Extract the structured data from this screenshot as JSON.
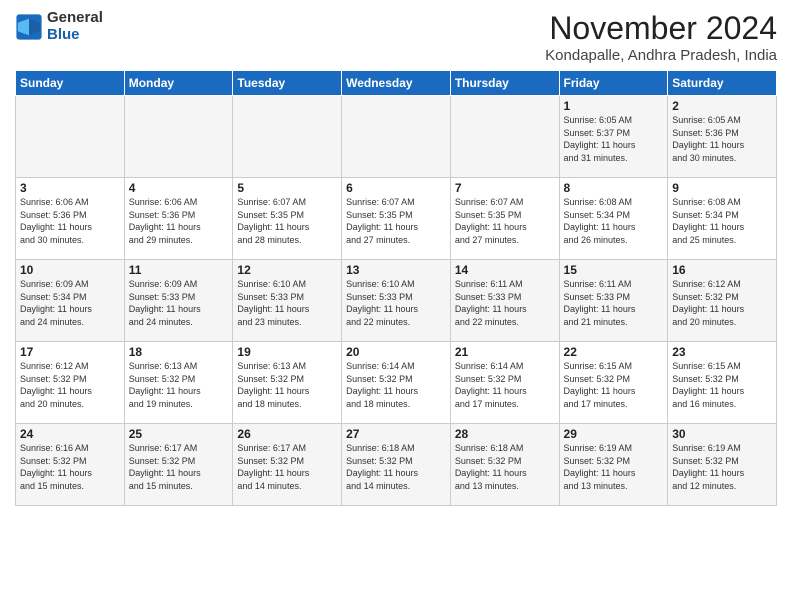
{
  "header": {
    "logo_general": "General",
    "logo_blue": "Blue",
    "month": "November 2024",
    "location": "Kondapalle, Andhra Pradesh, India"
  },
  "weekdays": [
    "Sunday",
    "Monday",
    "Tuesday",
    "Wednesday",
    "Thursday",
    "Friday",
    "Saturday"
  ],
  "weeks": [
    [
      {
        "day": "",
        "info": ""
      },
      {
        "day": "",
        "info": ""
      },
      {
        "day": "",
        "info": ""
      },
      {
        "day": "",
        "info": ""
      },
      {
        "day": "",
        "info": ""
      },
      {
        "day": "1",
        "info": "Sunrise: 6:05 AM\nSunset: 5:37 PM\nDaylight: 11 hours\nand 31 minutes."
      },
      {
        "day": "2",
        "info": "Sunrise: 6:05 AM\nSunset: 5:36 PM\nDaylight: 11 hours\nand 30 minutes."
      }
    ],
    [
      {
        "day": "3",
        "info": "Sunrise: 6:06 AM\nSunset: 5:36 PM\nDaylight: 11 hours\nand 30 minutes."
      },
      {
        "day": "4",
        "info": "Sunrise: 6:06 AM\nSunset: 5:36 PM\nDaylight: 11 hours\nand 29 minutes."
      },
      {
        "day": "5",
        "info": "Sunrise: 6:07 AM\nSunset: 5:35 PM\nDaylight: 11 hours\nand 28 minutes."
      },
      {
        "day": "6",
        "info": "Sunrise: 6:07 AM\nSunset: 5:35 PM\nDaylight: 11 hours\nand 27 minutes."
      },
      {
        "day": "7",
        "info": "Sunrise: 6:07 AM\nSunset: 5:35 PM\nDaylight: 11 hours\nand 27 minutes."
      },
      {
        "day": "8",
        "info": "Sunrise: 6:08 AM\nSunset: 5:34 PM\nDaylight: 11 hours\nand 26 minutes."
      },
      {
        "day": "9",
        "info": "Sunrise: 6:08 AM\nSunset: 5:34 PM\nDaylight: 11 hours\nand 25 minutes."
      }
    ],
    [
      {
        "day": "10",
        "info": "Sunrise: 6:09 AM\nSunset: 5:34 PM\nDaylight: 11 hours\nand 24 minutes."
      },
      {
        "day": "11",
        "info": "Sunrise: 6:09 AM\nSunset: 5:33 PM\nDaylight: 11 hours\nand 24 minutes."
      },
      {
        "day": "12",
        "info": "Sunrise: 6:10 AM\nSunset: 5:33 PM\nDaylight: 11 hours\nand 23 minutes."
      },
      {
        "day": "13",
        "info": "Sunrise: 6:10 AM\nSunset: 5:33 PM\nDaylight: 11 hours\nand 22 minutes."
      },
      {
        "day": "14",
        "info": "Sunrise: 6:11 AM\nSunset: 5:33 PM\nDaylight: 11 hours\nand 22 minutes."
      },
      {
        "day": "15",
        "info": "Sunrise: 6:11 AM\nSunset: 5:33 PM\nDaylight: 11 hours\nand 21 minutes."
      },
      {
        "day": "16",
        "info": "Sunrise: 6:12 AM\nSunset: 5:32 PM\nDaylight: 11 hours\nand 20 minutes."
      }
    ],
    [
      {
        "day": "17",
        "info": "Sunrise: 6:12 AM\nSunset: 5:32 PM\nDaylight: 11 hours\nand 20 minutes."
      },
      {
        "day": "18",
        "info": "Sunrise: 6:13 AM\nSunset: 5:32 PM\nDaylight: 11 hours\nand 19 minutes."
      },
      {
        "day": "19",
        "info": "Sunrise: 6:13 AM\nSunset: 5:32 PM\nDaylight: 11 hours\nand 18 minutes."
      },
      {
        "day": "20",
        "info": "Sunrise: 6:14 AM\nSunset: 5:32 PM\nDaylight: 11 hours\nand 18 minutes."
      },
      {
        "day": "21",
        "info": "Sunrise: 6:14 AM\nSunset: 5:32 PM\nDaylight: 11 hours\nand 17 minutes."
      },
      {
        "day": "22",
        "info": "Sunrise: 6:15 AM\nSunset: 5:32 PM\nDaylight: 11 hours\nand 17 minutes."
      },
      {
        "day": "23",
        "info": "Sunrise: 6:15 AM\nSunset: 5:32 PM\nDaylight: 11 hours\nand 16 minutes."
      }
    ],
    [
      {
        "day": "24",
        "info": "Sunrise: 6:16 AM\nSunset: 5:32 PM\nDaylight: 11 hours\nand 15 minutes."
      },
      {
        "day": "25",
        "info": "Sunrise: 6:17 AM\nSunset: 5:32 PM\nDaylight: 11 hours\nand 15 minutes."
      },
      {
        "day": "26",
        "info": "Sunrise: 6:17 AM\nSunset: 5:32 PM\nDaylight: 11 hours\nand 14 minutes."
      },
      {
        "day": "27",
        "info": "Sunrise: 6:18 AM\nSunset: 5:32 PM\nDaylight: 11 hours\nand 14 minutes."
      },
      {
        "day": "28",
        "info": "Sunrise: 6:18 AM\nSunset: 5:32 PM\nDaylight: 11 hours\nand 13 minutes."
      },
      {
        "day": "29",
        "info": "Sunrise: 6:19 AM\nSunset: 5:32 PM\nDaylight: 11 hours\nand 13 minutes."
      },
      {
        "day": "30",
        "info": "Sunrise: 6:19 AM\nSunset: 5:32 PM\nDaylight: 11 hours\nand 12 minutes."
      }
    ]
  ]
}
